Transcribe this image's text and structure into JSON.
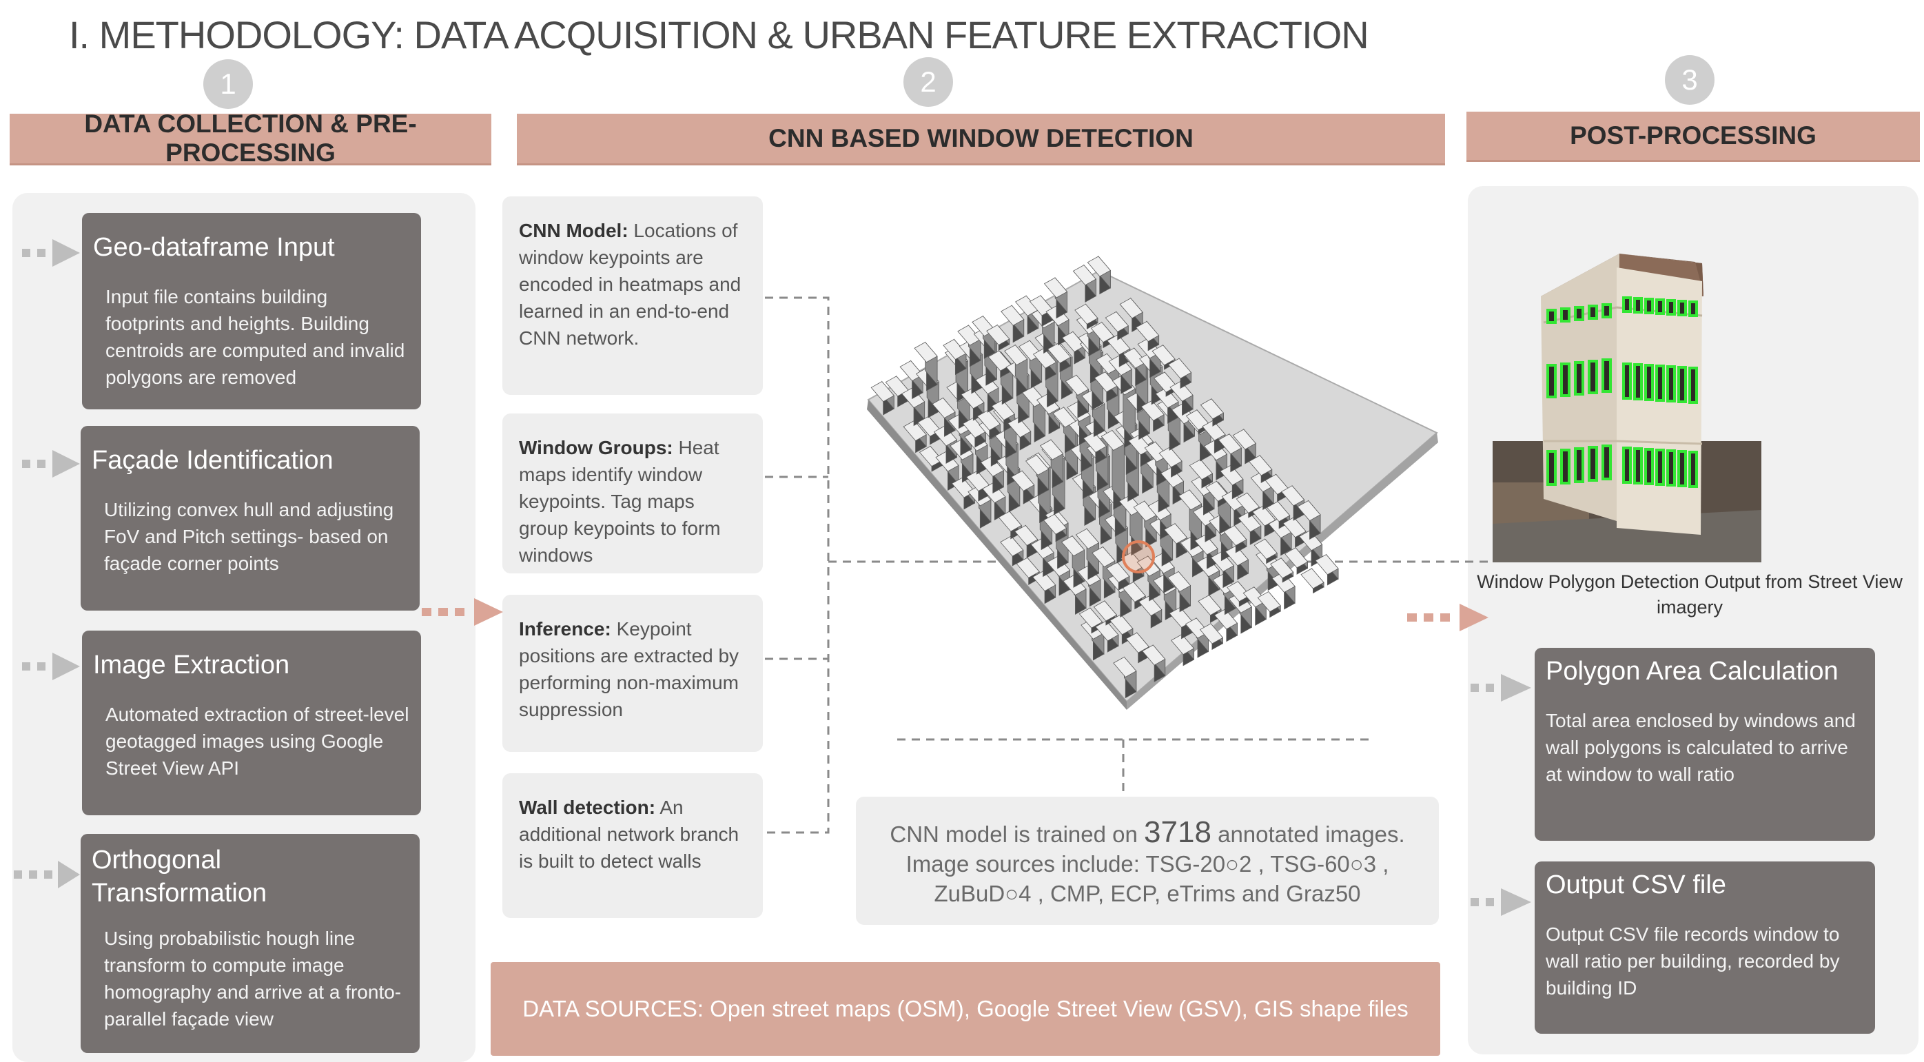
{
  "title": "I. METHODOLOGY: DATA ACQUISITION & URBAN FEATURE EXTRACTION",
  "steps": [
    {
      "number": "1",
      "header": "DATA COLLECTION & PRE-PROCESSING"
    },
    {
      "number": "2",
      "header": "CNN BASED WINDOW DETECTION"
    },
    {
      "number": "3",
      "header": "POST-PROCESSING"
    }
  ],
  "left_cards": [
    {
      "title": "Geo-dataframe Input",
      "body": "Input file contains building footprints and heights. Building centroids are computed and invalid polygons are removed"
    },
    {
      "title": "Façade Identification",
      "body": "Utilizing convex hull and adjusting FoV and Pitch settings-  based on façade corner points"
    },
    {
      "title": "Image Extraction",
      "body": "Automated extraction of street-level geotagged images using Google Street View API"
    },
    {
      "title": "Orthogonal Transformation",
      "body": "Using probabilistic hough line transform to compute image homography and arrive at a fronto-parallel façade view"
    }
  ],
  "cnn_cards": [
    {
      "label": "CNN Model:",
      "text": " Locations of window keypoints are encoded in heatmaps and learned in an end-to-end CNN network."
    },
    {
      "label": "Window Groups:",
      "text": " Heat maps identify window keypoints. Tag maps group keypoints to form windows"
    },
    {
      "label": "Inference:",
      "text": " Keypoint positions are extracted by performing non-maximum suppression"
    },
    {
      "label": "Wall detection:",
      "text": " An additional network branch is built to detect walls"
    }
  ],
  "training": {
    "prefix": "CNN model is trained on ",
    "count": "3718",
    "suffix": " annotated images.",
    "line2": "Image sources include: TSG-20○2 , TSG-60○3 ,",
    "line3": "ZuBuD○4 , CMP, ECP, eTrims and Graz50"
  },
  "data_sources": "DATA SOURCES: Open street maps (OSM), Google Street View (GSV), GIS shape files",
  "right_caption": "Window Polygon Detection Output from Street View imagery",
  "right_cards": [
    {
      "title": "Polygon Area Calculation",
      "body": "Total area enclosed by windows and wall polygons is calculated to arrive at window to wall ratio"
    },
    {
      "title": "Output CSV file",
      "body": "Output CSV file records window to wall ratio per building, recorded by building ID"
    }
  ],
  "colors": {
    "accent": "#d6a89a",
    "card_dark": "#767170",
    "card_light": "#eeeeee",
    "window_outline": "#33e633",
    "highlight": "#e0805a"
  }
}
